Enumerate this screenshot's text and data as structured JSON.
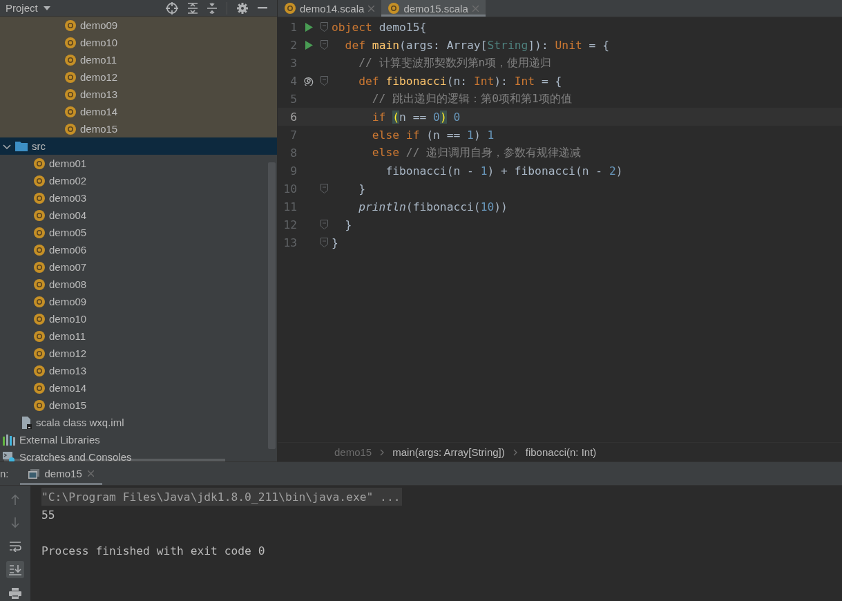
{
  "project_panel": {
    "title": "Project"
  },
  "project_tree": {
    "partial_items": [
      {
        "label": "demo09",
        "kind": "object"
      },
      {
        "label": "demo10",
        "kind": "object"
      },
      {
        "label": "demo11",
        "kind": "object"
      },
      {
        "label": "demo12",
        "kind": "object"
      },
      {
        "label": "demo13",
        "kind": "object"
      },
      {
        "label": "demo14",
        "kind": "object"
      },
      {
        "label": "demo15",
        "kind": "object"
      }
    ],
    "nodes": [
      {
        "label": "src",
        "kind": "folder",
        "expanded": true,
        "selected": true,
        "children": [
          {
            "label": "demo01",
            "kind": "object"
          },
          {
            "label": "demo02",
            "kind": "object"
          },
          {
            "label": "demo03",
            "kind": "object"
          },
          {
            "label": "demo04",
            "kind": "object"
          },
          {
            "label": "demo05",
            "kind": "object"
          },
          {
            "label": "demo06",
            "kind": "object"
          },
          {
            "label": "demo07",
            "kind": "object"
          },
          {
            "label": "demo08",
            "kind": "object"
          },
          {
            "label": "demo09",
            "kind": "object"
          },
          {
            "label": "demo10",
            "kind": "object"
          },
          {
            "label": "demo11",
            "kind": "object"
          },
          {
            "label": "demo12",
            "kind": "object"
          },
          {
            "label": "demo13",
            "kind": "object"
          },
          {
            "label": "demo14",
            "kind": "object"
          },
          {
            "label": "demo15",
            "kind": "object"
          }
        ]
      },
      {
        "label": "scala class wxq.iml",
        "kind": "file"
      },
      {
        "label": "External Libraries",
        "kind": "libraries"
      },
      {
        "label": "Scratches and Consoles",
        "kind": "scratches"
      }
    ]
  },
  "editor_tabs": [
    {
      "label": "demo14.scala",
      "selected": false
    },
    {
      "label": "demo15.scala",
      "selected": true
    }
  ],
  "code_lines": [
    {
      "number": "1",
      "gutter_icon": {
        "kind": "run"
      },
      "fold": true,
      "current": false,
      "tokens": [
        {
          "t": "object",
          "kind": "kw"
        },
        {
          "t": " demo15{",
          "kind": "plain"
        }
      ]
    },
    {
      "number": "2",
      "gutter_icon": {
        "kind": "run"
      },
      "fold": true,
      "current": false,
      "tokens": [
        {
          "t": "  def ",
          "kind": "kw"
        },
        {
          "t": "main",
          "kind": "decl"
        },
        {
          "t": "(args: Array[",
          "kind": "plain"
        },
        {
          "t": "String",
          "kind": "tparam"
        },
        {
          "t": "]): ",
          "kind": "plain"
        },
        {
          "t": "Unit",
          "kind": "kw"
        },
        {
          "t": " = {",
          "kind": "plain"
        }
      ]
    },
    {
      "number": "3",
      "fold": false,
      "current": false,
      "tokens": [
        {
          "t": "    // 计算斐波那契数列第n项，使用递归",
          "kind": "comment"
        }
      ]
    },
    {
      "number": "4",
      "gutter_icon": {
        "kind": "recursion"
      },
      "fold": true,
      "current": false,
      "tokens": [
        {
          "t": "    def ",
          "kind": "kw"
        },
        {
          "t": "fibonacci",
          "kind": "decl"
        },
        {
          "t": "(n: ",
          "kind": "plain"
        },
        {
          "t": "Int",
          "kind": "kw"
        },
        {
          "t": "): ",
          "kind": "plain"
        },
        {
          "t": "Int",
          "kind": "kw"
        },
        {
          "t": " = {",
          "kind": "plain"
        }
      ]
    },
    {
      "number": "5",
      "fold": false,
      "current": false,
      "tokens": [
        {
          "t": "      // 跳出递归的逻辑：第0项和第1项的值",
          "kind": "comment"
        }
      ]
    },
    {
      "number": "6",
      "fold": false,
      "current": true,
      "tokens": [
        {
          "t": "      if ",
          "kind": "kw"
        },
        {
          "t": "(",
          "kind": "match"
        },
        {
          "t": "n == ",
          "kind": "plain"
        },
        {
          "t": "0",
          "kind": "num"
        },
        {
          "t": ")",
          "kind": "match"
        },
        {
          "t": " 0",
          "kind": "num"
        }
      ]
    },
    {
      "number": "7",
      "fold": false,
      "current": false,
      "tokens": [
        {
          "t": "      else if",
          "kind": "kw"
        },
        {
          "t": " (n == ",
          "kind": "plain"
        },
        {
          "t": "1",
          "kind": "num"
        },
        {
          "t": ") ",
          "kind": "plain"
        },
        {
          "t": "1",
          "kind": "num"
        }
      ]
    },
    {
      "number": "8",
      "fold": false,
      "current": false,
      "tokens": [
        {
          "t": "      else",
          "kind": "kw"
        },
        {
          "t": " // 递归调用自身，参数有规律递减",
          "kind": "comment"
        }
      ]
    },
    {
      "number": "9",
      "fold": false,
      "current": false,
      "tokens": [
        {
          "t": "        fibonacci(n - ",
          "kind": "plain"
        },
        {
          "t": "1",
          "kind": "num"
        },
        {
          "t": ") + fibonacci(n - ",
          "kind": "plain"
        },
        {
          "t": "2",
          "kind": "num"
        },
        {
          "t": ")",
          "kind": "plain"
        }
      ]
    },
    {
      "number": "10",
      "fold": true,
      "current": false,
      "tokens": [
        {
          "t": "    }",
          "kind": "plain"
        }
      ]
    },
    {
      "number": "11",
      "fold": false,
      "current": false,
      "tokens": [
        {
          "t": "    println",
          "kind": "italic"
        },
        {
          "t": "(fibonacci(",
          "kind": "plain"
        },
        {
          "t": "10",
          "kind": "num"
        },
        {
          "t": "))",
          "kind": "plain"
        }
      ]
    },
    {
      "number": "12",
      "fold": true,
      "current": false,
      "tokens": [
        {
          "t": "  }",
          "kind": "plain"
        }
      ]
    },
    {
      "number": "13",
      "fold": true,
      "current": false,
      "tokens": [
        {
          "t": "}",
          "kind": "plain"
        }
      ]
    }
  ],
  "breadcrumbs": [
    "demo15",
    "main(args: Array[String])",
    "fibonacci(n: Int)"
  ],
  "run_panel": {
    "label": "n:",
    "tabs": [
      {
        "label": "demo15",
        "selected": true
      }
    ],
    "console_lines": [
      {
        "text": "\"C:\\Program Files\\Java\\jdk1.8.0_211\\bin\\java.exe\" ...",
        "kind": "command"
      },
      {
        "text": "55",
        "kind": "output"
      },
      {
        "text": "Process finished with exit code 0",
        "kind": "status"
      }
    ],
    "tools": [
      {
        "kind": "up",
        "disabled": true
      },
      {
        "kind": "down",
        "disabled": true
      },
      {
        "kind": "wrap",
        "selected": false
      },
      {
        "kind": "scroll-end",
        "selected": true
      },
      {
        "kind": "print",
        "selected": false
      }
    ]
  }
}
